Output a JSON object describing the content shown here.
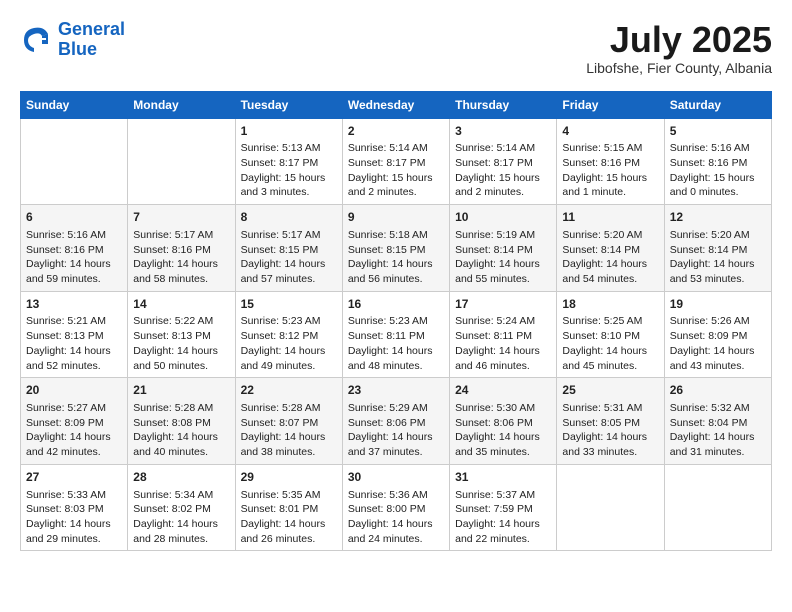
{
  "header": {
    "logo_line1": "General",
    "logo_line2": "Blue",
    "month_title": "July 2025",
    "subtitle": "Libofshe, Fier County, Albania"
  },
  "weekdays": [
    "Sunday",
    "Monday",
    "Tuesday",
    "Wednesday",
    "Thursday",
    "Friday",
    "Saturday"
  ],
  "weeks": [
    [
      {
        "day": "",
        "content": ""
      },
      {
        "day": "",
        "content": ""
      },
      {
        "day": "1",
        "content": "Sunrise: 5:13 AM\nSunset: 8:17 PM\nDaylight: 15 hours\nand 3 minutes."
      },
      {
        "day": "2",
        "content": "Sunrise: 5:14 AM\nSunset: 8:17 PM\nDaylight: 15 hours\nand 2 minutes."
      },
      {
        "day": "3",
        "content": "Sunrise: 5:14 AM\nSunset: 8:17 PM\nDaylight: 15 hours\nand 2 minutes."
      },
      {
        "day": "4",
        "content": "Sunrise: 5:15 AM\nSunset: 8:16 PM\nDaylight: 15 hours\nand 1 minute."
      },
      {
        "day": "5",
        "content": "Sunrise: 5:16 AM\nSunset: 8:16 PM\nDaylight: 15 hours\nand 0 minutes."
      }
    ],
    [
      {
        "day": "6",
        "content": "Sunrise: 5:16 AM\nSunset: 8:16 PM\nDaylight: 14 hours\nand 59 minutes."
      },
      {
        "day": "7",
        "content": "Sunrise: 5:17 AM\nSunset: 8:16 PM\nDaylight: 14 hours\nand 58 minutes."
      },
      {
        "day": "8",
        "content": "Sunrise: 5:17 AM\nSunset: 8:15 PM\nDaylight: 14 hours\nand 57 minutes."
      },
      {
        "day": "9",
        "content": "Sunrise: 5:18 AM\nSunset: 8:15 PM\nDaylight: 14 hours\nand 56 minutes."
      },
      {
        "day": "10",
        "content": "Sunrise: 5:19 AM\nSunset: 8:14 PM\nDaylight: 14 hours\nand 55 minutes."
      },
      {
        "day": "11",
        "content": "Sunrise: 5:20 AM\nSunset: 8:14 PM\nDaylight: 14 hours\nand 54 minutes."
      },
      {
        "day": "12",
        "content": "Sunrise: 5:20 AM\nSunset: 8:14 PM\nDaylight: 14 hours\nand 53 minutes."
      }
    ],
    [
      {
        "day": "13",
        "content": "Sunrise: 5:21 AM\nSunset: 8:13 PM\nDaylight: 14 hours\nand 52 minutes."
      },
      {
        "day": "14",
        "content": "Sunrise: 5:22 AM\nSunset: 8:13 PM\nDaylight: 14 hours\nand 50 minutes."
      },
      {
        "day": "15",
        "content": "Sunrise: 5:23 AM\nSunset: 8:12 PM\nDaylight: 14 hours\nand 49 minutes."
      },
      {
        "day": "16",
        "content": "Sunrise: 5:23 AM\nSunset: 8:11 PM\nDaylight: 14 hours\nand 48 minutes."
      },
      {
        "day": "17",
        "content": "Sunrise: 5:24 AM\nSunset: 8:11 PM\nDaylight: 14 hours\nand 46 minutes."
      },
      {
        "day": "18",
        "content": "Sunrise: 5:25 AM\nSunset: 8:10 PM\nDaylight: 14 hours\nand 45 minutes."
      },
      {
        "day": "19",
        "content": "Sunrise: 5:26 AM\nSunset: 8:09 PM\nDaylight: 14 hours\nand 43 minutes."
      }
    ],
    [
      {
        "day": "20",
        "content": "Sunrise: 5:27 AM\nSunset: 8:09 PM\nDaylight: 14 hours\nand 42 minutes."
      },
      {
        "day": "21",
        "content": "Sunrise: 5:28 AM\nSunset: 8:08 PM\nDaylight: 14 hours\nand 40 minutes."
      },
      {
        "day": "22",
        "content": "Sunrise: 5:28 AM\nSunset: 8:07 PM\nDaylight: 14 hours\nand 38 minutes."
      },
      {
        "day": "23",
        "content": "Sunrise: 5:29 AM\nSunset: 8:06 PM\nDaylight: 14 hours\nand 37 minutes."
      },
      {
        "day": "24",
        "content": "Sunrise: 5:30 AM\nSunset: 8:06 PM\nDaylight: 14 hours\nand 35 minutes."
      },
      {
        "day": "25",
        "content": "Sunrise: 5:31 AM\nSunset: 8:05 PM\nDaylight: 14 hours\nand 33 minutes."
      },
      {
        "day": "26",
        "content": "Sunrise: 5:32 AM\nSunset: 8:04 PM\nDaylight: 14 hours\nand 31 minutes."
      }
    ],
    [
      {
        "day": "27",
        "content": "Sunrise: 5:33 AM\nSunset: 8:03 PM\nDaylight: 14 hours\nand 29 minutes."
      },
      {
        "day": "28",
        "content": "Sunrise: 5:34 AM\nSunset: 8:02 PM\nDaylight: 14 hours\nand 28 minutes."
      },
      {
        "day": "29",
        "content": "Sunrise: 5:35 AM\nSunset: 8:01 PM\nDaylight: 14 hours\nand 26 minutes."
      },
      {
        "day": "30",
        "content": "Sunrise: 5:36 AM\nSunset: 8:00 PM\nDaylight: 14 hours\nand 24 minutes."
      },
      {
        "day": "31",
        "content": "Sunrise: 5:37 AM\nSunset: 7:59 PM\nDaylight: 14 hours\nand 22 minutes."
      },
      {
        "day": "",
        "content": ""
      },
      {
        "day": "",
        "content": ""
      }
    ]
  ]
}
